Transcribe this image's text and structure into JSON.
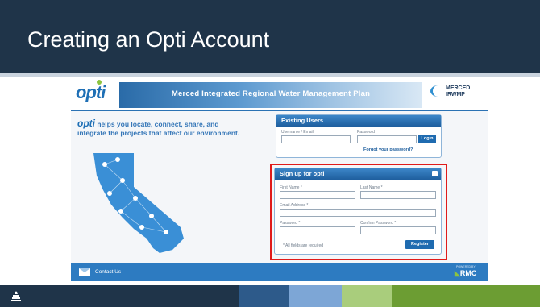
{
  "slide": {
    "title": "Creating an Opti Account",
    "colors": {
      "title_bar": "#1f3449",
      "bottom_dark": "#1f3449",
      "bottom_mid": "#2d5a8a",
      "bottom_light": "#7da6d6",
      "bottom_green_light": "#a9cd7c",
      "bottom_green": "#6c9d33"
    }
  },
  "site": {
    "logo": "opti",
    "banner_title": "Merced Integrated Regional Water Management Plan",
    "partner_logo_line1": "MERCED",
    "partner_logo_line2": "IRWMP",
    "tagline_brand": "opti",
    "tagline_text": " helps you locate, connect, share, and integrate the projects that affect our environment.",
    "existing_users": {
      "heading": "Existing Users",
      "username_label": "Username / Email",
      "password_label": "Password",
      "login_button": "Login",
      "forgot_link": "Forgot your password?"
    },
    "signup": {
      "heading": "Sign up for opti",
      "first_name_label": "First Name *",
      "last_name_label": "Last Name *",
      "email_label": "Email Address *",
      "password_label": "Password *",
      "confirm_password_label": "Confirm Password *",
      "required_note": "* All fields are required",
      "register_button": "Register"
    },
    "footer": {
      "contact_label": "Contact Us",
      "powered_by": "POWERED BY",
      "powered_logo": "RMC"
    },
    "colors": {
      "primary_blue": "#1f6bb0",
      "highlight_red": "#e01b1b",
      "map_blue": "#3a8fd6"
    }
  }
}
